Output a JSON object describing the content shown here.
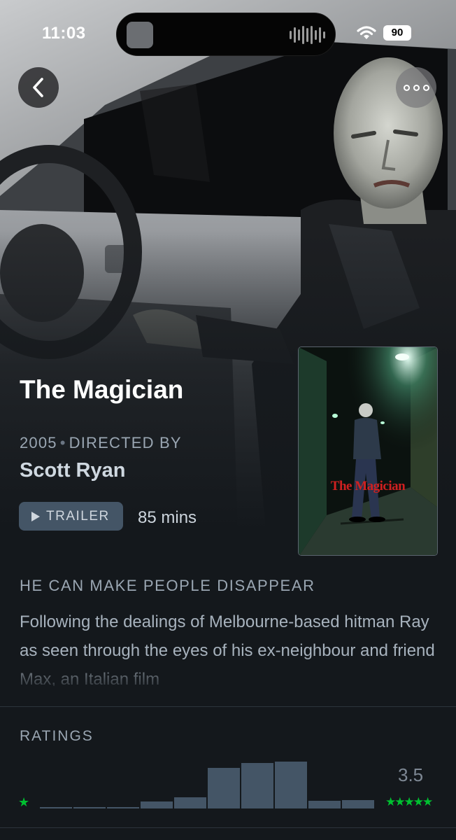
{
  "status_bar": {
    "time": "11:03",
    "battery": "90"
  },
  "film": {
    "title": "The Magician",
    "year": "2005",
    "directed_by_label": "DIRECTED BY",
    "director": "Scott Ryan",
    "trailer_label": "TRAILER",
    "runtime": "85 mins",
    "poster_title": "The Magician",
    "tagline": "HE CAN MAKE PEOPLE DISAPPEAR",
    "synopsis": "Following the dealings of Melbourne-based hitman Ray as seen through the eyes of his ex-neighbour and friend Max, an Italian film"
  },
  "ratings": {
    "label": "RATINGS",
    "average": "3.5",
    "low_star": "★",
    "high_stars": "★★★★★",
    "histogram": [
      0.02,
      0.02,
      0.02,
      0.11,
      0.17,
      0.61,
      0.68,
      0.7,
      0.12,
      0.13
    ]
  },
  "colors": {
    "accent_green": "#00c030",
    "bar": "#445566",
    "background": "#14181c"
  },
  "icons": {
    "back": "chevron-left-icon",
    "more": "ellipsis-icon",
    "play": "play-icon",
    "wifi": "wifi-icon"
  }
}
